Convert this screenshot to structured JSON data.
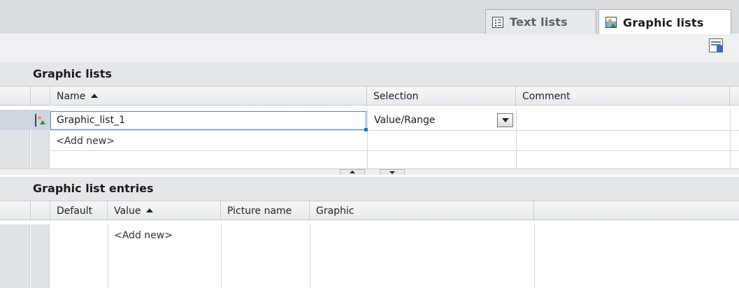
{
  "tabs": [
    {
      "label": "Text lists",
      "icon": "text-list-icon",
      "active": false
    },
    {
      "label": "Graphic lists",
      "icon": "graphic-list-icon",
      "active": true
    }
  ],
  "toolbar": {
    "icon": "view-options-icon"
  },
  "graphic_lists": {
    "title": "Graphic lists",
    "columns": [
      "Name",
      "Selection",
      "Comment"
    ],
    "rows": [
      {
        "name": "Graphic_list_1",
        "selection": "Value/Range",
        "comment": ""
      }
    ],
    "add_new": "<Add new>"
  },
  "entries": {
    "title": "Graphic list entries",
    "columns": [
      "Default",
      "Value",
      "Picture name",
      "Graphic"
    ],
    "add_new": "<Add new>"
  },
  "colors": {
    "selection_border": "#4a89d8",
    "header_bg": "#e4e7e9",
    "tabstrip_bg": "#d9dde0"
  }
}
